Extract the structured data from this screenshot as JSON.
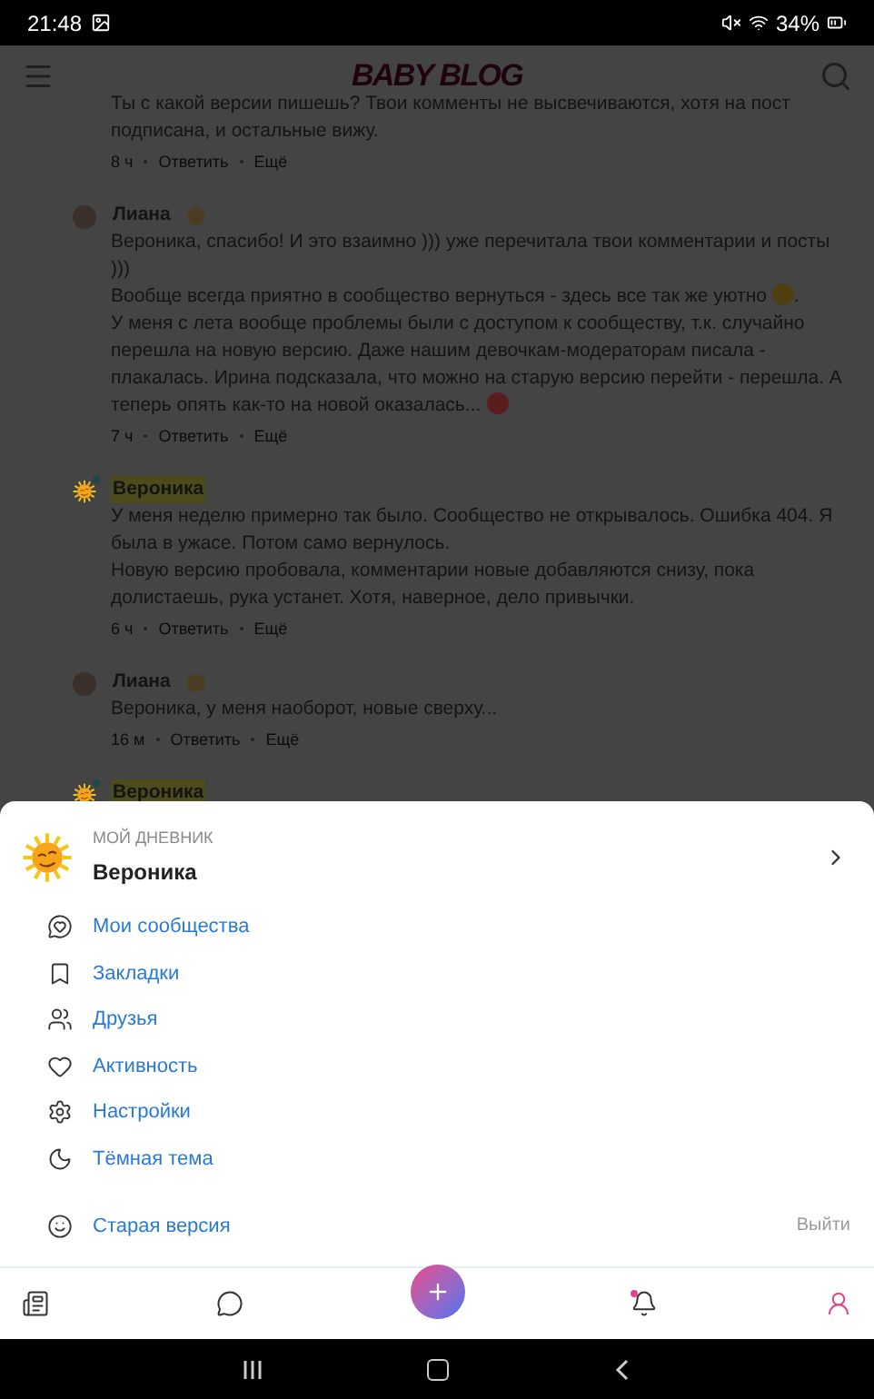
{
  "status_bar": {
    "time": "21:48",
    "battery": "34%"
  },
  "header": {
    "logo": "BABY BLOG"
  },
  "comments": [
    {
      "paragraphs": [
        [
          {
            "text": "Ты с какой версии пишешь? Твои комменты не высвечиваются, хотя на пост подписана, и остальные вижу."
          }
        ]
      ],
      "time": "8 ч",
      "actions": [
        "Ответить",
        "Ещё"
      ]
    },
    {
      "author": "Лиана",
      "kind": "photo",
      "has_badge": true,
      "highlighted": false,
      "paragraphs": [
        [
          {
            "text": "Вероника, спасибо! И это взаимно ))) уже перечитала твои комментарии и посты )))"
          }
        ],
        [
          {
            "text": "Вообще всегда приятно в сообщество вернуться - здесь все так же уютно "
          },
          {
            "kind": "emoji",
            "color": "#4d3f12"
          },
          {
            "text": "."
          }
        ],
        [
          {
            "text": "У меня с лета вообще проблемы были с доступом к сообществу, т.к. случайно перешла на новую версию. Даже нашим девочкам-модераторам писала - плакалась. Ирина подсказала, что можно на старую версию перейти - перешла. А теперь опять как-то на новой оказалась... "
          },
          {
            "kind": "emoji",
            "color": "#5a1d1d"
          }
        ]
      ],
      "time": "7 ч",
      "actions": [
        "Ответить",
        "Ещё"
      ]
    },
    {
      "author": "Вероника",
      "kind": "sun",
      "has_badge": false,
      "highlighted": true,
      "paragraphs": [
        [
          {
            "text": "У меня неделю примерно так было. Сообщество не открывалось. Ошибка 404. Я была в ужасе. Потом само вернулось."
          }
        ],
        [
          {
            "text": "Новую версию пробовала, комментарии новые добавляются снизу, пока долистаешь, рука устанет. Хотя, наверное, дело привычки."
          }
        ]
      ],
      "time": "6 ч",
      "actions": [
        "Ответить",
        "Ещё"
      ]
    },
    {
      "author": "Лиана",
      "kind": "photo",
      "has_badge": true,
      "highlighted": false,
      "paragraphs": [
        [
          {
            "text": "Вероника, у меня наоборот, новые сверху..."
          }
        ]
      ],
      "time": "16 м",
      "actions": [
        "Ответить",
        "Ещё"
      ]
    },
    {
      "author": "Вероника",
      "kind": "sun",
      "has_badge": false,
      "highlighted": true
    }
  ],
  "sheet": {
    "caption": "МОЙ ДНЕВНИК",
    "name": "Вероника",
    "menu": [
      {
        "label": "Мои сообщества"
      },
      {
        "label": "Закладки"
      },
      {
        "label": "Друзья"
      },
      {
        "label": "Активность"
      },
      {
        "label": "Настройки"
      },
      {
        "label": "Тёмная тема"
      }
    ],
    "old_version": "Старая версия",
    "logout": "Выйти"
  },
  "bottom_nav": [
    {
      "kind": "tab",
      "selected": false,
      "badge": false
    },
    {
      "kind": "tab",
      "selected": false,
      "badge": false
    },
    {
      "kind": "action"
    },
    {
      "kind": "tab",
      "selected": false,
      "badge": true
    },
    {
      "kind": "tab",
      "selected": true,
      "badge": false
    }
  ]
}
